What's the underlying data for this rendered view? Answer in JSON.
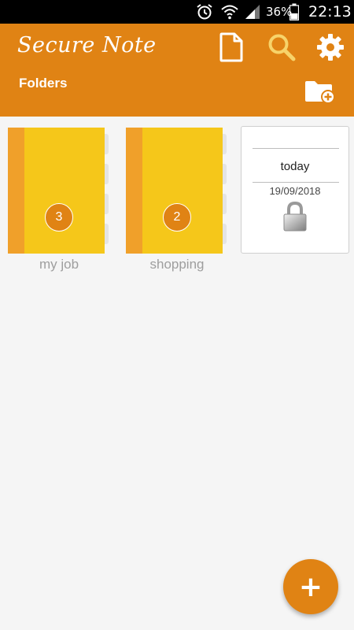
{
  "status_bar": {
    "battery_percent": "36%",
    "time": "22:13",
    "icons": [
      "alarm-icon",
      "wifi-icon",
      "signal-icon",
      "battery-icon"
    ]
  },
  "app_bar": {
    "title": "Secure Note",
    "section": "Folders",
    "actions": [
      "new-note-icon",
      "search-icon",
      "settings-icon",
      "add-folder-icon"
    ]
  },
  "folders": [
    {
      "name": "my job",
      "count": "3"
    },
    {
      "name": "shopping",
      "count": "2"
    }
  ],
  "notes": [
    {
      "title": "today",
      "date": "19/09/2018",
      "locked": true
    }
  ],
  "fab": {
    "label": "+"
  },
  "colors": {
    "accent": "#e08314",
    "notebook": "#f5c71a",
    "notebook_spine": "#f0a02a",
    "background": "#f5f5f5"
  }
}
